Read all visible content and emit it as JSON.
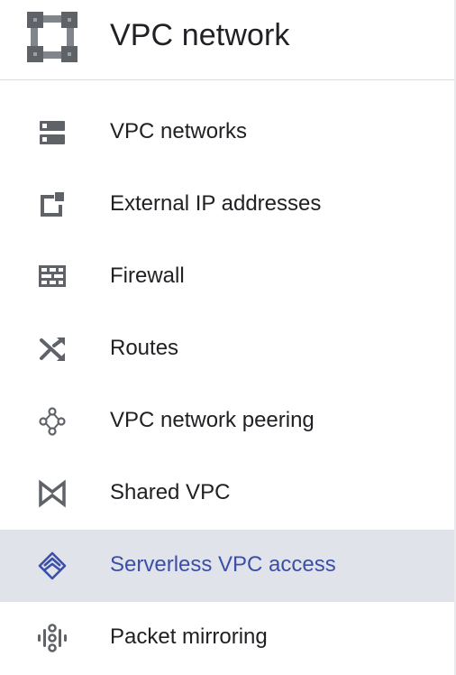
{
  "header": {
    "title": "VPC network",
    "logo_icon": "vpc-network-logo-icon"
  },
  "colors": {
    "active_bg": "#e0e3ea",
    "active_text": "#3c4fa8",
    "icon": "#5f6368",
    "text": "#202124"
  },
  "nav": {
    "items": [
      {
        "label": "VPC networks",
        "icon": "vpc-networks-icon",
        "active": false
      },
      {
        "label": "External IP addresses",
        "icon": "external-ip-icon",
        "active": false
      },
      {
        "label": "Firewall",
        "icon": "firewall-icon",
        "active": false
      },
      {
        "label": "Routes",
        "icon": "routes-icon",
        "active": false
      },
      {
        "label": "VPC network peering",
        "icon": "peering-icon",
        "active": false
      },
      {
        "label": "Shared VPC",
        "icon": "shared-vpc-icon",
        "active": false
      },
      {
        "label": "Serverless VPC access",
        "icon": "serverless-vpc-icon",
        "active": true
      },
      {
        "label": "Packet mirroring",
        "icon": "packet-mirroring-icon",
        "active": false
      }
    ]
  }
}
